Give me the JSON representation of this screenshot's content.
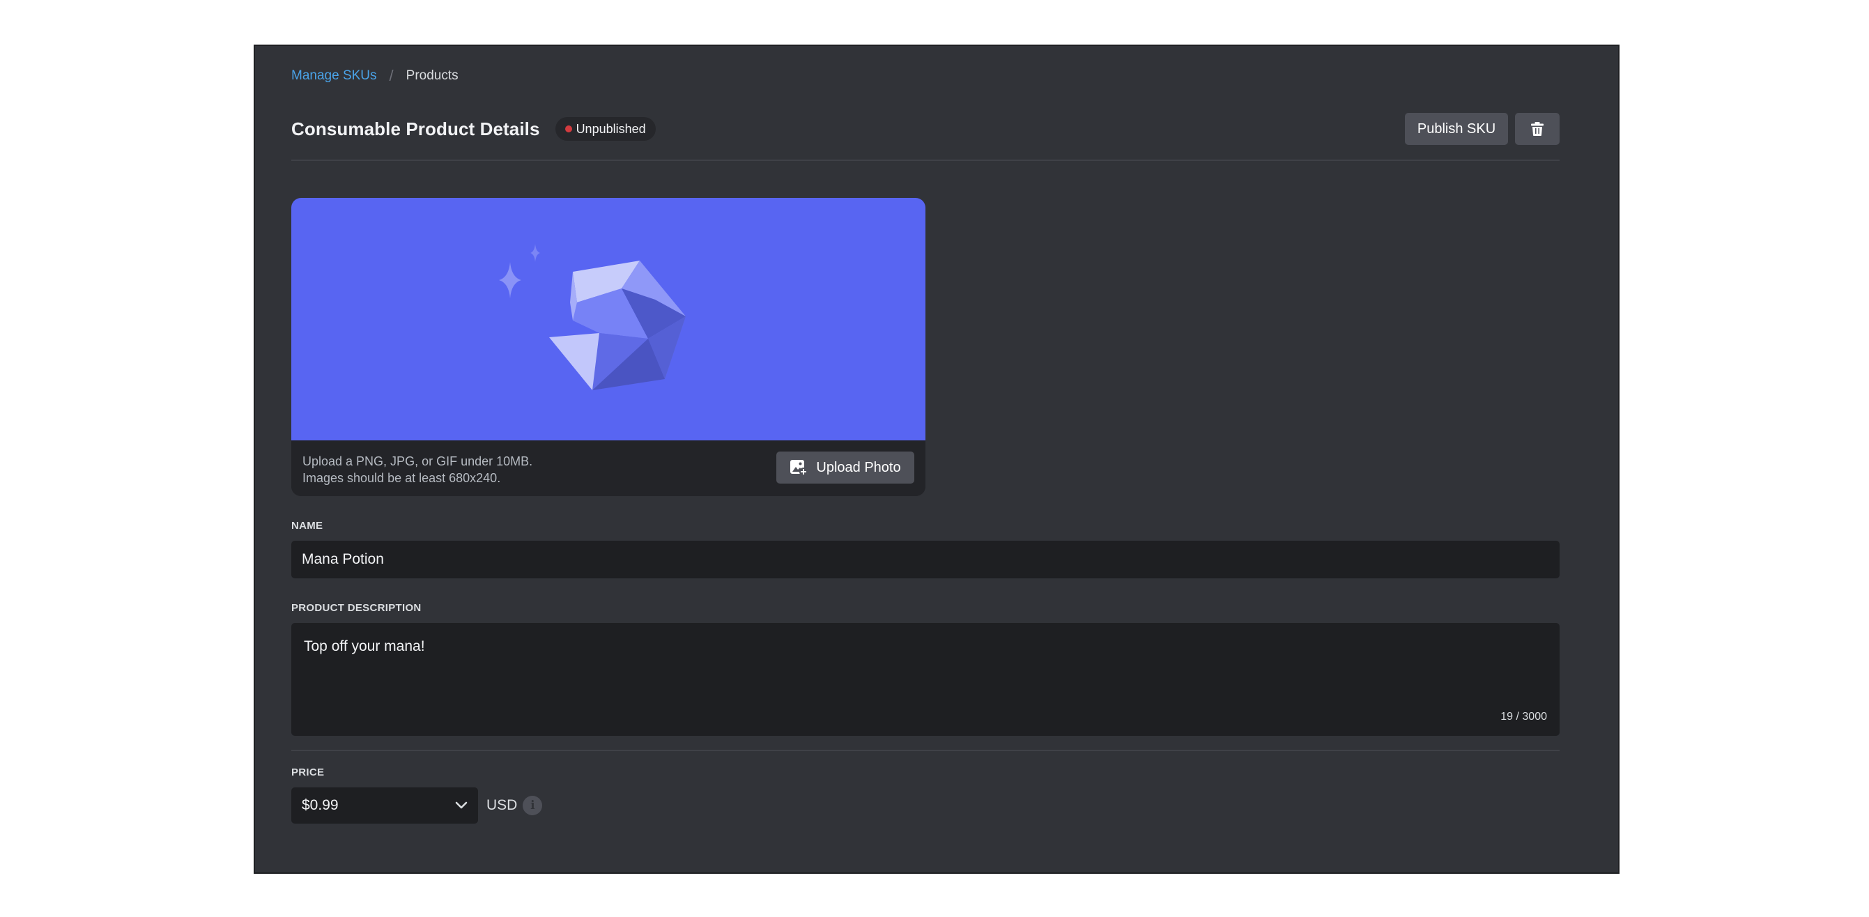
{
  "breadcrumb": {
    "parent": "Manage SKUs",
    "separator": "/",
    "current": "Products"
  },
  "header": {
    "title": "Consumable Product Details",
    "status": "Unpublished",
    "status_color": "#f23f43",
    "publish_label": "Publish SKU",
    "delete_icon": "trash-icon"
  },
  "image_upload": {
    "preview_color": "#5865f2",
    "preview_icon": "gem-icon",
    "hint_line1": "Upload a PNG, JPG, or GIF under 10MB.",
    "hint_line2": "Images should be at least 680x240.",
    "upload_label": "Upload Photo",
    "upload_icon": "add-image-icon"
  },
  "name_field": {
    "label": "NAME",
    "value": "Mana Potion"
  },
  "description_field": {
    "label": "PRODUCT DESCRIPTION",
    "value": "Top off your mana!",
    "counter": "19 / 3000"
  },
  "price_field": {
    "label": "PRICE",
    "selected": "$0.99",
    "currency": "USD",
    "info_icon": "info-icon"
  },
  "colors": {
    "accent": "#5865f2",
    "link": "#4aa3e8",
    "panel_bg": "#313338",
    "input_bg": "#1e1f22"
  }
}
